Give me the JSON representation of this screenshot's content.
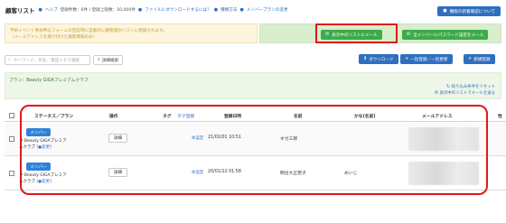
{
  "header": {
    "title": "顧客リスト",
    "help": "ヘルプ",
    "count_text": "登録件数：6件 / 登録上限数：50,000件",
    "download_help": "ファイルにダウンロードするには？",
    "guide": "種類方法",
    "member_plan": "メンバープランの変更",
    "right_button": "機能の新着確認について"
  },
  "notice": {
    "line1": "予約イベント参加申込フォームの回答時に自動的に顧客個別リストに登録されます。",
    "line2": "（メールアドレスを受け付けた顧客情報のみ）"
  },
  "actions": {
    "email_selected": "表示中のリストにメール",
    "email_all_password": "全メンバーにパスワード設定をメール"
  },
  "search": {
    "placeholder": "キーワード、氏名、電話メモで検索",
    "detail": "詳細検索",
    "download": "ダウンロード",
    "bulk_register": "一括登録／一括更新",
    "new_register": "新規登録"
  },
  "plan": {
    "label": "プラン：Beauty GIGAプレミアムクラブ",
    "reset": "絞り込み条件をリセット",
    "email_list": "表示中のリストでメールを送る"
  },
  "table": {
    "columns": [
      "ステータス／プラン",
      "操作",
      "タグ",
      "タグ登録",
      "登録日時",
      "名前",
      "かな(名前)",
      "メールアドレス",
      "性"
    ],
    "rows": [
      {
        "status": "メンバー",
        "plan_line1": "Beauty GIGAプレミア",
        "plan_line2": "ムクラブ",
        "change": "[●変更]",
        "action": "詳細",
        "tag_setting": "設定",
        "date": "21/02/01 10:51",
        "name": "ギガ三郎",
        "kana": ""
      },
      {
        "status": "メンバー",
        "plan_line1": "Beauty GIGAプレミア",
        "plan_line2": "ムクラブ",
        "change": "[●変更]",
        "action": "詳細",
        "tag_setting": "設定",
        "date": "20/01/12 01:58",
        "name": "明治大正若子",
        "kana": "めいじ"
      }
    ]
  },
  "colors": {
    "primary_blue": "#2f6fbf",
    "green_button": "#3eaa4a",
    "highlight_red": "#e01818"
  }
}
